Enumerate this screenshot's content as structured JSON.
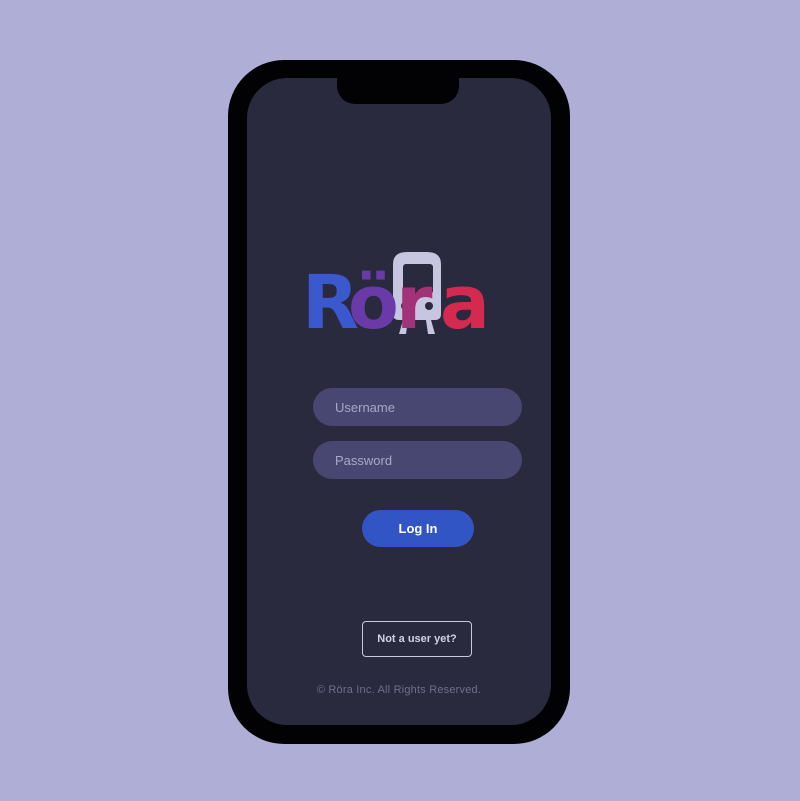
{
  "brand": {
    "name": "Röra",
    "letters": [
      "R",
      "ö",
      "r",
      "a"
    ],
    "letter_colors": [
      "#3b59cf",
      "#6a3aa8",
      "#a33378",
      "#d42a4f"
    ],
    "icon": "train-icon"
  },
  "form": {
    "username_placeholder": "Username",
    "password_placeholder": "Password",
    "login_label": "Log In"
  },
  "signup": {
    "label": "Not a user yet?"
  },
  "footer": {
    "copyright": "© Röra Inc. All Rights Reserved."
  },
  "colors": {
    "background": "#aeaed6",
    "screen": "#292a3e",
    "input": "#474771",
    "primary_button": "#3155c4"
  }
}
